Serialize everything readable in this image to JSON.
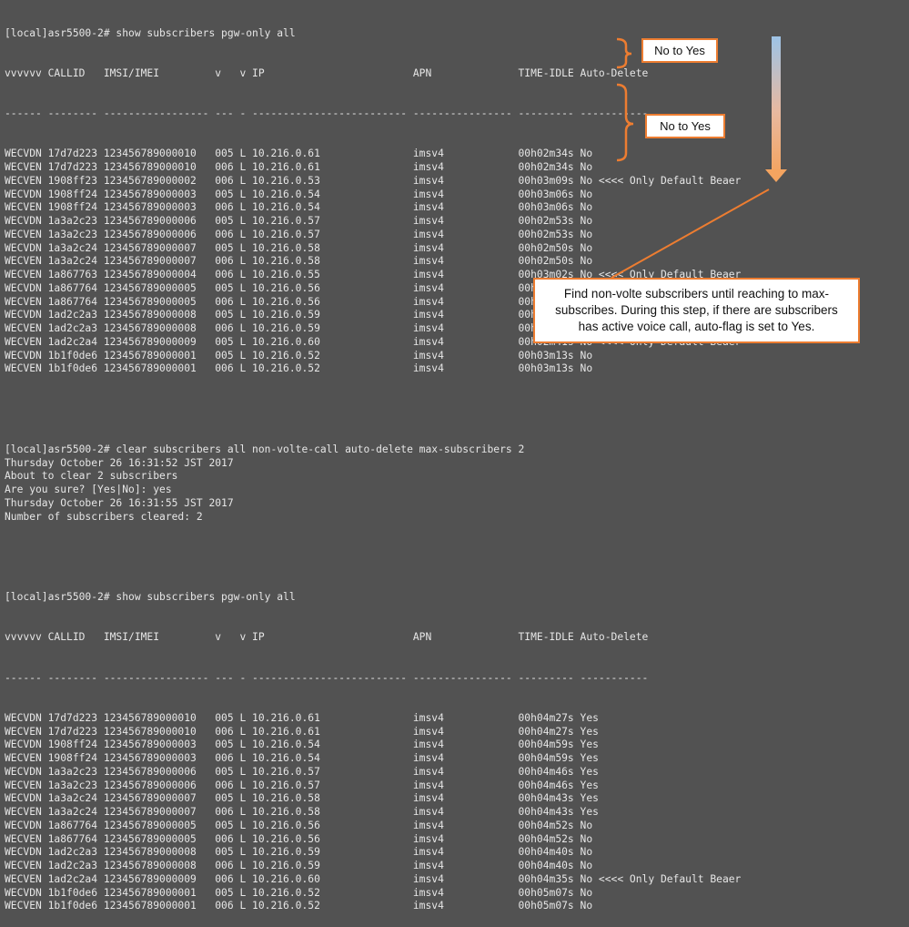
{
  "colors": {
    "background": "#525252",
    "text": "#e6e6e6",
    "accent_orange": "#ed7d31",
    "arrow_top": "#9dc3e6",
    "arrow_bottom": "#f4a460",
    "spell_squiggle": "#e04a4a"
  },
  "terminal": {
    "prompt1": "[local]asr5500-2# show subscribers pgw-only all",
    "header": "vvvvvv CALLID   IMSI/IMEI         v   v IP                        APN              TIME-IDLE Auto-Delete",
    "divider": "------ -------- ----------------- --- - ------------------------- ---------------- --------- -----------",
    "rows1": [
      "WECVDN 17d7d223 123456789000010   005 L 10.216.0.61               imsv4            00h02m34s No",
      "WECVEN 17d7d223 123456789000010   006 L 10.216.0.61               imsv4            00h02m34s No",
      "WECVEN 1908ff23 123456789000002   006 L 10.216.0.53               imsv4            00h03m09s No <<<< Only Default Beaer",
      "WECVDN 1908ff24 123456789000003   005 L 10.216.0.54               imsv4            00h03m06s No",
      "WECVEN 1908ff24 123456789000003   006 L 10.216.0.54               imsv4            00h03m06s No",
      "WECVDN 1a3a2c23 123456789000006   005 L 10.216.0.57               imsv4            00h02m53s No",
      "WECVEN 1a3a2c23 123456789000006   006 L 10.216.0.57               imsv4            00h02m53s No",
      "WECVDN 1a3a2c24 123456789000007   005 L 10.216.0.58               imsv4            00h02m50s No",
      "WECVEN 1a3a2c24 123456789000007   006 L 10.216.0.58               imsv4            00h02m50s No",
      "WECVEN 1a867763 123456789000004   006 L 10.216.0.55               imsv4            00h03m02s No <<<< Only Default Beaer",
      "WECVDN 1a867764 123456789000005   005 L 10.216.0.56               imsv4            00h02m58s No",
      "WECVEN 1a867764 123456789000005   006 L 10.216.0.56               imsv4            00h02m58s No",
      "WECVDN 1ad2c2a3 123456789000008   005 L 10.216.0.59               imsv4            00h02m46s No",
      "WECVEN 1ad2c2a3 123456789000008   006 L 10.216.0.59               imsv4            00h02m46s No",
      "WECVEN 1ad2c2a4 123456789000009   005 L 10.216.0.60               imsv4            00h02m41s No <<<< Only Default Beaer",
      "WECVDN 1b1f0de6 123456789000001   005 L 10.216.0.52               imsv4            00h03m13s No",
      "WECVEN 1b1f0de6 123456789000001   006 L 10.216.0.52               imsv4            00h03m13s No"
    ],
    "clear_block": [
      "[local]asr5500-2# clear subscribers all non-volte-call auto-delete max-subscribers 2",
      "Thursday October 26 16:31:52 JST 2017",
      "About to clear 2 subscribers",
      "Are you sure? [Yes|No]: yes",
      "Thursday October 26 16:31:55 JST 2017",
      "Number of subscribers cleared: 2"
    ],
    "prompt2": "[local]asr5500-2# show subscribers pgw-only all",
    "rows2": [
      "WECVDN 17d7d223 123456789000010   005 L 10.216.0.61               imsv4            00h04m27s Yes",
      "WECVEN 17d7d223 123456789000010   006 L 10.216.0.61               imsv4            00h04m27s Yes",
      "WECVDN 1908ff24 123456789000003   005 L 10.216.0.54               imsv4            00h04m59s Yes",
      "WECVEN 1908ff24 123456789000003   006 L 10.216.0.54               imsv4            00h04m59s Yes",
      "WECVDN 1a3a2c23 123456789000006   005 L 10.216.0.57               imsv4            00h04m46s Yes",
      "WECVEN 1a3a2c23 123456789000006   006 L 10.216.0.57               imsv4            00h04m46s Yes",
      "WECVDN 1a3a2c24 123456789000007   005 L 10.216.0.58               imsv4            00h04m43s Yes",
      "WECVEN 1a3a2c24 123456789000007   006 L 10.216.0.58               imsv4            00h04m43s Yes",
      "WECVDN 1a867764 123456789000005   005 L 10.216.0.56               imsv4            00h04m52s No",
      "WECVEN 1a867764 123456789000005   006 L 10.216.0.56               imsv4            00h04m52s No",
      "WECVDN 1ad2c2a3 123456789000008   005 L 10.216.0.59               imsv4            00h04m40s No",
      "WECVEN 1ad2c2a3 123456789000008   006 L 10.216.0.59               imsv4            00h04m40s No",
      "WECVEN 1ad2c2a4 123456789000009   006 L 10.216.0.60               imsv4            00h04m35s No <<<< Only Default Beaer",
      "WECVDN 1b1f0de6 123456789000001   005 L 10.216.0.52               imsv4            00h05m07s No",
      "WECVEN 1b1f0de6 123456789000001   006 L 10.216.0.52               imsv4            00h05m07s No"
    ]
  },
  "annotations": {
    "callout1": "No to Yes",
    "callout2": "No to Yes",
    "note": "Find non-volte subscribers until reaching to max-subscribes. During this step, if there are subscribers has active voice call, auto-flag is set to Yes."
  }
}
